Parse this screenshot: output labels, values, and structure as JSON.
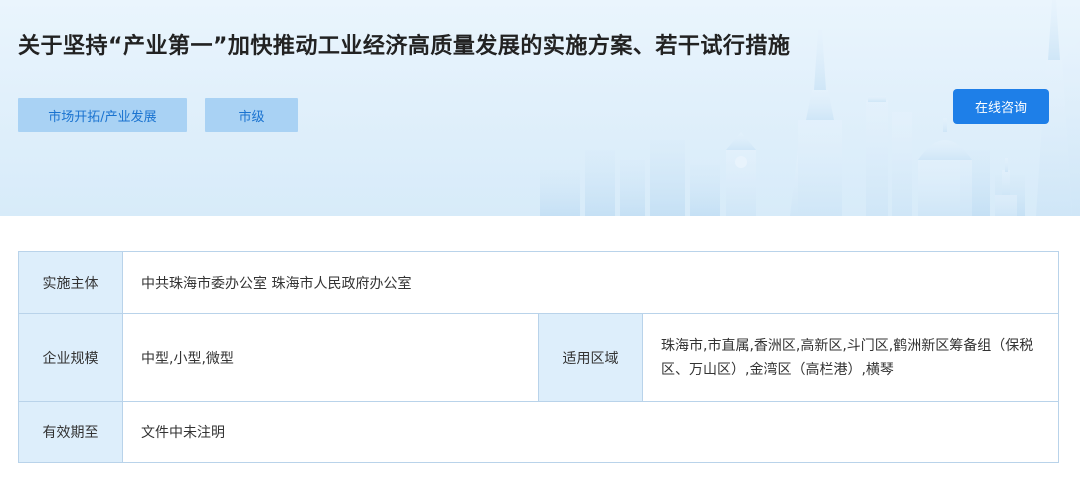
{
  "header": {
    "title": "关于坚持“产业第一”加快推动工业经济高质量发展的实施方案、若干试行措施",
    "tags": [
      "市场开拓/产业发展",
      "市级"
    ],
    "consult_button": "在线咨询"
  },
  "info": {
    "implementer": {
      "label": "实施主体",
      "value": "中共珠海市委办公室 珠海市人民政府办公室"
    },
    "enterprise_scale": {
      "label": "企业规模",
      "value": "中型,小型,微型"
    },
    "applicable_area": {
      "label": "适用区域",
      "value": "珠海市,市直属,香洲区,高新区,斗门区,鹤洲新区筹备组（保税区、万山区）,金湾区（高栏港）,横琴"
    },
    "valid_until": {
      "label": "有效期至",
      "value": "文件中未注明"
    }
  },
  "colors": {
    "banner_bg": "#e1f0fb",
    "tag_bg": "#a9d2f4",
    "tag_text": "#1a73d0",
    "button_bg": "#1e7fe8",
    "label_bg": "#ddeefb",
    "border": "#b9d3ea"
  }
}
